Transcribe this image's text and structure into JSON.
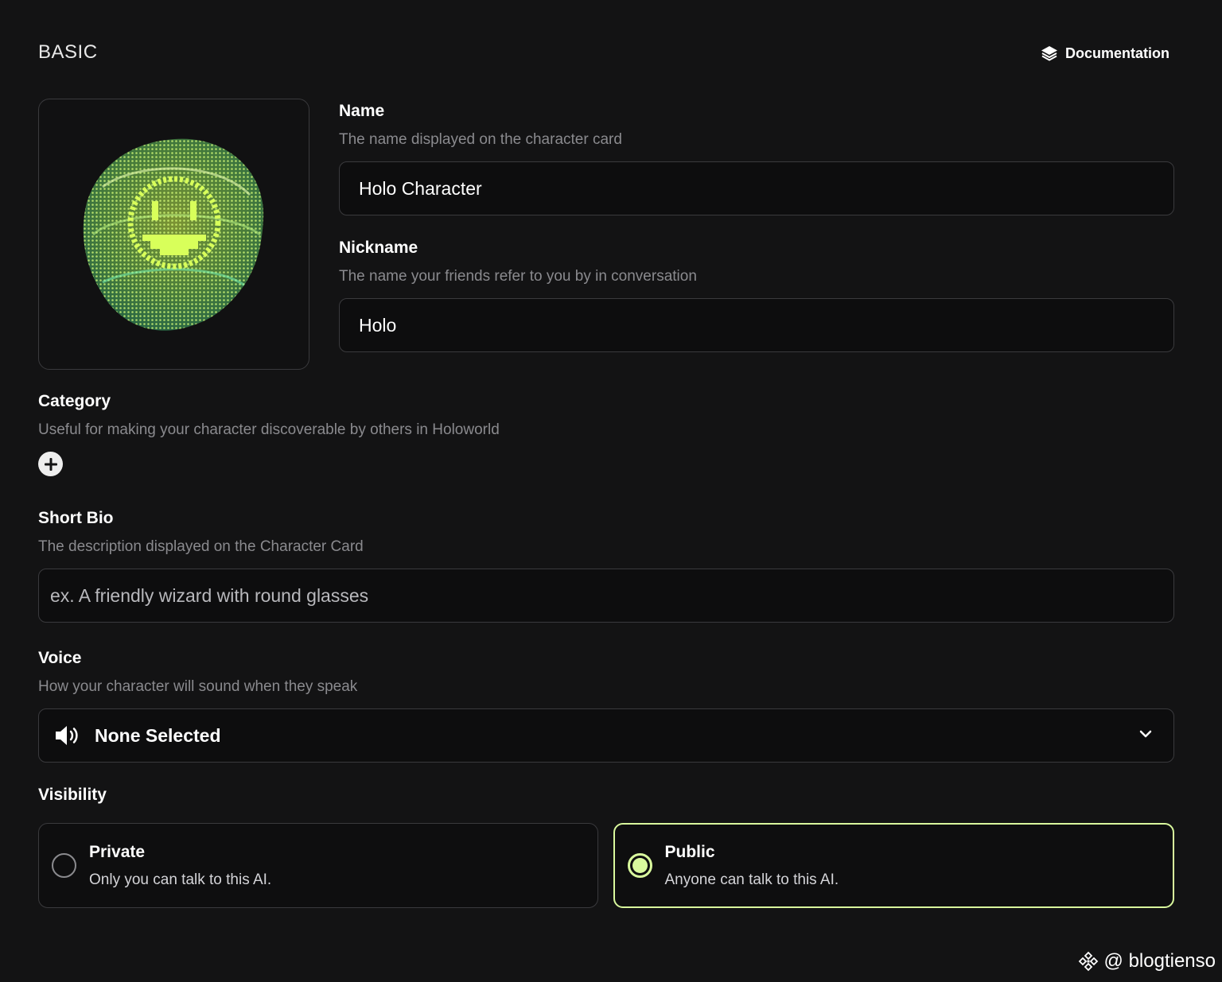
{
  "header": {
    "section_title": "BASIC",
    "doc_link_label": "Documentation",
    "doc_icon": "layers-icon"
  },
  "avatar": {
    "alt": "holographic smiley avatar",
    "colors": [
      "#c8ff4a",
      "#7dff6a",
      "#3ee6a0"
    ]
  },
  "fields": {
    "name": {
      "label": "Name",
      "hint": "The name displayed on the character card",
      "value": "Holo Character"
    },
    "nickname": {
      "label": "Nickname",
      "hint": "The name your friends refer to you by in conversation",
      "value": "Holo"
    },
    "category": {
      "label": "Category",
      "hint": "Useful for making your character discoverable by others in Holoworld",
      "add_icon": "plus-circle-icon"
    },
    "short_bio": {
      "label": "Short Bio",
      "hint": "The description displayed on the Character Card",
      "placeholder": "ex. A friendly wizard with round glasses"
    },
    "voice": {
      "label": "Voice",
      "hint": "How your character will sound when they speak",
      "value": "None Selected",
      "icon": "speaker-icon"
    }
  },
  "visibility": {
    "label": "Visibility",
    "options": [
      {
        "title": "Private",
        "desc": "Only you can talk to this AI.",
        "selected": false
      },
      {
        "title": "Public",
        "desc": "Anyone can talk to this AI.",
        "selected": true
      }
    ],
    "accent": "#d9f99d"
  },
  "watermark": {
    "text": "@ blogtienso"
  }
}
